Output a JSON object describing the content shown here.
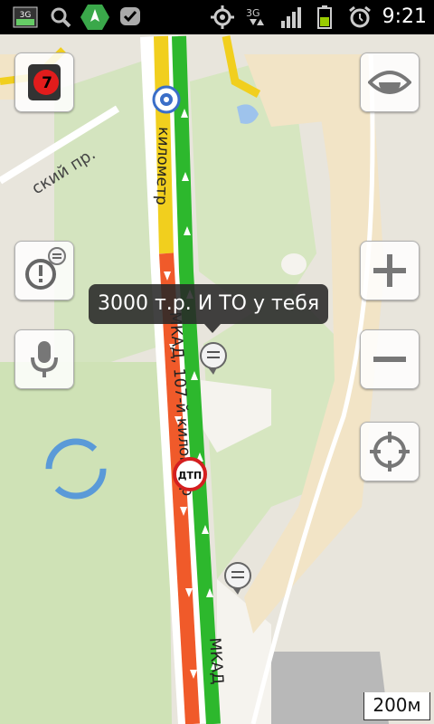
{
  "status_bar": {
    "time": "9:21",
    "network_type": "3G",
    "icons": [
      "3g-upload-icon",
      "search-icon",
      "navigation-app-icon",
      "check-bubble-icon",
      "gps-icon",
      "3g-signal-icon",
      "signal-bars-icon",
      "battery-icon",
      "alarm-icon"
    ]
  },
  "traffic_level": "7",
  "map": {
    "road_labels": [
      "ский пр.",
      "километр",
      "МКАД, 107-й километр",
      "МКАД"
    ],
    "incident_label": "ДТП",
    "scale_label": "200м",
    "colors": {
      "traffic_green": "#2db82d",
      "traffic_yellow": "#f1cf1e",
      "traffic_red": "#f05a2a",
      "park_green": "#cfe2b6",
      "sand": "#f2e4c6"
    }
  },
  "comment_bubble": {
    "text": "3000 т.р. И ТО у тебя"
  },
  "controls": {
    "left": [
      "traffic-button",
      "report-event-button",
      "voice-search-button"
    ],
    "right": [
      "layers-view-button",
      "zoom-in-button",
      "zoom-out-button",
      "my-location-button"
    ]
  }
}
